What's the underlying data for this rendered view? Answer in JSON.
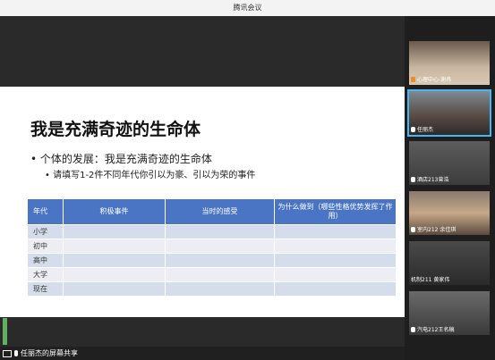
{
  "window": {
    "title": "腾讯会议"
  },
  "slide": {
    "title": "我是充满奇迹的生命体",
    "bullet1": "• 个体的发展：我是充满奇迹的生命体",
    "bullet2": "• 请填写1-2件不同年代你引以为豪、引以为荣的事件",
    "table": {
      "headers": [
        "年代",
        "积极事件",
        "当时的感受",
        "为什么做到（哪些性格优势发挥了作用）"
      ],
      "rows": [
        [
          "小学",
          "",
          "",
          ""
        ],
        [
          "初中",
          "",
          "",
          ""
        ],
        [
          "高中",
          "",
          "",
          ""
        ],
        [
          "大学",
          "",
          "",
          ""
        ],
        [
          "现在",
          "",
          "",
          ""
        ]
      ]
    }
  },
  "participants": [
    {
      "name": "心理中心-谢冉",
      "icon": "host-badge-icon"
    },
    {
      "name": "任丽杰",
      "icon": "mic-icon"
    },
    {
      "name": "酒店213曾浩",
      "icon": "mic-icon"
    },
    {
      "name": "室内212 余佳琪",
      "icon": "mic-icon"
    },
    {
      "name": "机制211 黄家伟",
      "icon": ""
    },
    {
      "name": "汽电212王名稿",
      "icon": "mic-icon"
    }
  ],
  "bottombar": {
    "share_label": "任丽杰的屏幕共享"
  },
  "colors": {
    "header_blue": "#4a74c4",
    "active_outline": "#49b5f5"
  }
}
